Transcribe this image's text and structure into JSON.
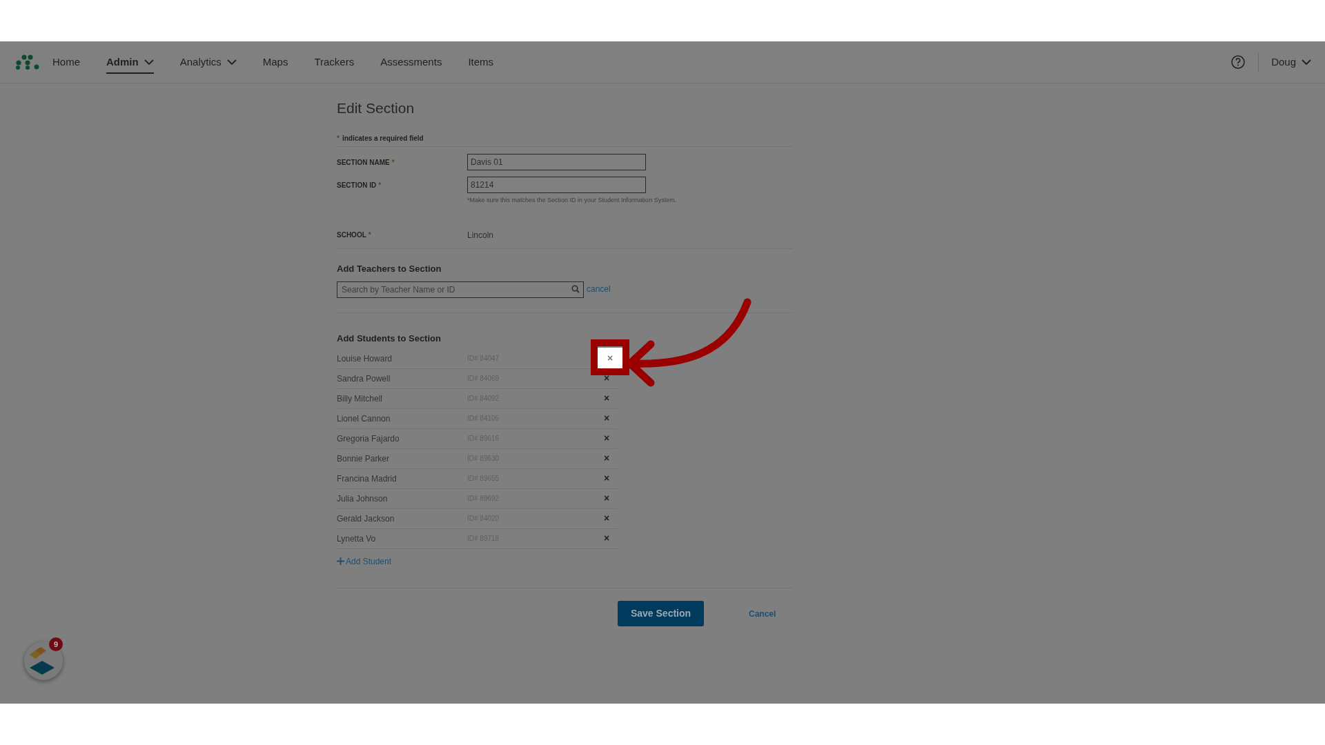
{
  "nav": {
    "items": [
      {
        "label": "Home",
        "selected": false,
        "dropdown": false
      },
      {
        "label": "Admin",
        "selected": true,
        "dropdown": true
      },
      {
        "label": "Analytics",
        "selected": false,
        "dropdown": true
      },
      {
        "label": "Maps",
        "selected": false,
        "dropdown": false
      },
      {
        "label": "Trackers",
        "selected": false,
        "dropdown": false
      },
      {
        "label": "Assessments",
        "selected": false,
        "dropdown": false
      },
      {
        "label": "Items",
        "selected": false,
        "dropdown": false
      }
    ],
    "user": "Doug"
  },
  "form": {
    "title": "Edit Section",
    "required_mark": "*",
    "required_note": "indicates a required field",
    "fields": [
      {
        "kind": "input",
        "label": "SECTION NAME",
        "mark": "*",
        "value": "Davis 01"
      },
      {
        "kind": "input",
        "label": "SECTION ID",
        "mark": "*",
        "value": "81214",
        "hint": "*Make sure this matches the Section ID in your Student Information System."
      },
      {
        "kind": "static",
        "label": "SCHOOL",
        "mark": "*",
        "value": "Lincoln"
      }
    ],
    "teachers": {
      "heading": "Add Teachers to Section",
      "placeholder": "Search by Teacher Name or ID",
      "cancel": "cancel"
    },
    "students": {
      "heading": "Add Students to Section",
      "rows": [
        {
          "name": "Louise Howard",
          "id": "ID# 84047",
          "remove": "×",
          "highlighted": true
        },
        {
          "name": "Sandra Powell",
          "id": "ID# 84069",
          "remove": "×",
          "highlighted": false
        },
        {
          "name": "Billy Mitchell",
          "id": "ID# 84092",
          "remove": "×",
          "highlighted": false
        },
        {
          "name": "Lionel Cannon",
          "id": "ID# 84105",
          "remove": "×",
          "highlighted": false
        },
        {
          "name": "Gregoria Fajardo",
          "id": "ID# 89616",
          "remove": "×",
          "highlighted": false
        },
        {
          "name": "Bonnie Parker",
          "id": "ID# 89630",
          "remove": "×",
          "highlighted": false
        },
        {
          "name": "Francina Madrid",
          "id": "ID# 89655",
          "remove": "×",
          "highlighted": false
        },
        {
          "name": "Julia Johnson",
          "id": "ID# 89692",
          "remove": "×",
          "highlighted": false
        },
        {
          "name": "Gerald Jackson",
          "id": "ID# 84020",
          "remove": "×",
          "highlighted": false
        },
        {
          "name": "Lynetta Vo",
          "id": "ID# 89718",
          "remove": "×",
          "highlighted": false
        }
      ],
      "add": "Add Student"
    },
    "save": "Save Section",
    "cancel": "Cancel"
  },
  "launcher": {
    "badge": "9"
  }
}
